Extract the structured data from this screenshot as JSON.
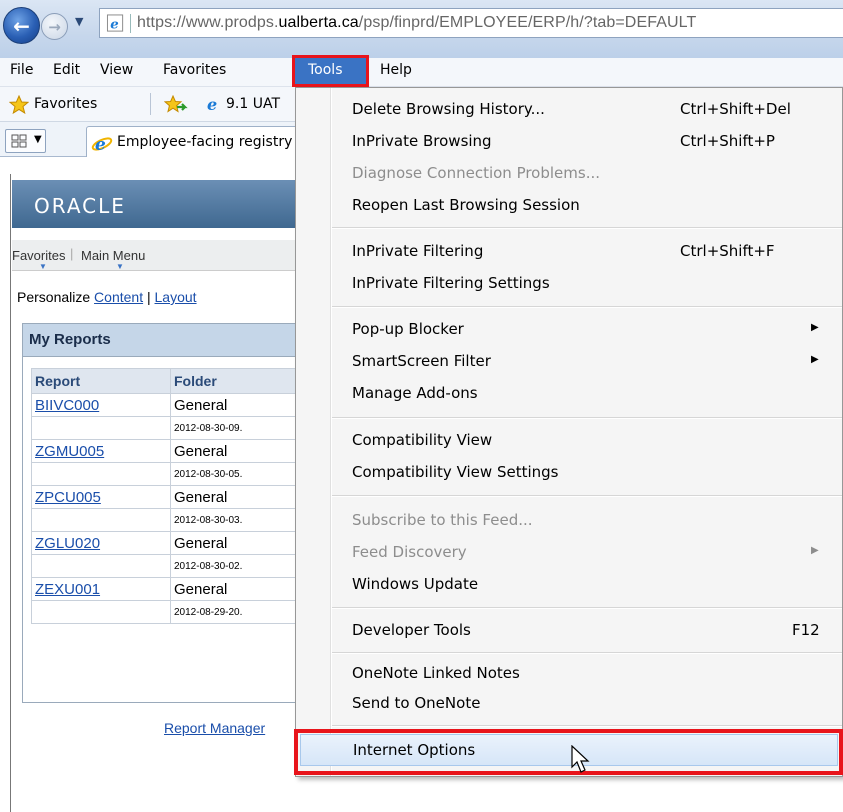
{
  "browser": {
    "url_prefix": "https://www.prodps.",
    "url_domain": "ualberta.ca",
    "url_suffix": "/psp/finprd/EMPLOYEE/ERP/h/?tab=DEFAULT",
    "menu": [
      "File",
      "Edit",
      "View",
      "Favorites",
      "Tools",
      "Help"
    ],
    "favorites_label": "Favorites",
    "fav_link": "9.1 UAT",
    "tab_title": "Employee-facing registry"
  },
  "page": {
    "logo": "ORACLE",
    "nav_favorites": "Favorites",
    "nav_main_menu": "Main Menu",
    "personalize": "Personalize",
    "content_link": "Content",
    "separator": "|",
    "layout_link": "Layout",
    "reports_title": "My Reports",
    "col_report": "Report",
    "col_folder": "Folder",
    "rows": [
      {
        "report": "BIIVC000",
        "folder": "General",
        "date": "2012-08-30-09."
      },
      {
        "report": "ZGMU005",
        "folder": "General",
        "date": "2012-08-30-05."
      },
      {
        "report": "ZPCU005",
        "folder": "General",
        "date": "2012-08-30-03."
      },
      {
        "report": "ZGLU020",
        "folder": "General",
        "date": "2012-08-30-02."
      },
      {
        "report": "ZEXU001",
        "folder": "General",
        "date": "2012-08-29-20."
      }
    ],
    "report_manager": "Report Manager"
  },
  "tools_menu": {
    "delete_history": "Delete Browsing History...",
    "delete_history_sc": "Ctrl+Shift+Del",
    "inprivate_browsing": "InPrivate Browsing",
    "inprivate_browsing_sc": "Ctrl+Shift+P",
    "diagnose": "Diagnose Connection Problems...",
    "reopen": "Reopen Last Browsing Session",
    "inprivate_filtering": "InPrivate Filtering",
    "inprivate_filtering_sc": "Ctrl+Shift+F",
    "inprivate_filtering_settings": "InPrivate Filtering Settings",
    "popup_blocker": "Pop-up Blocker",
    "smartscreen": "SmartScreen Filter",
    "manage_addons": "Manage Add-ons",
    "compat_view": "Compatibility View",
    "compat_view_settings": "Compatibility View Settings",
    "subscribe_feed": "Subscribe to this Feed...",
    "feed_discovery": "Feed Discovery",
    "windows_update": "Windows Update",
    "developer_tools": "Developer Tools",
    "developer_tools_sc": "F12",
    "onenote_linked": "OneNote Linked Notes",
    "send_onenote": "Send to OneNote",
    "internet_options": "Internet Options"
  },
  "colors": {
    "highlight_red": "#e8141b",
    "menu_active": "#3a73c4"
  }
}
